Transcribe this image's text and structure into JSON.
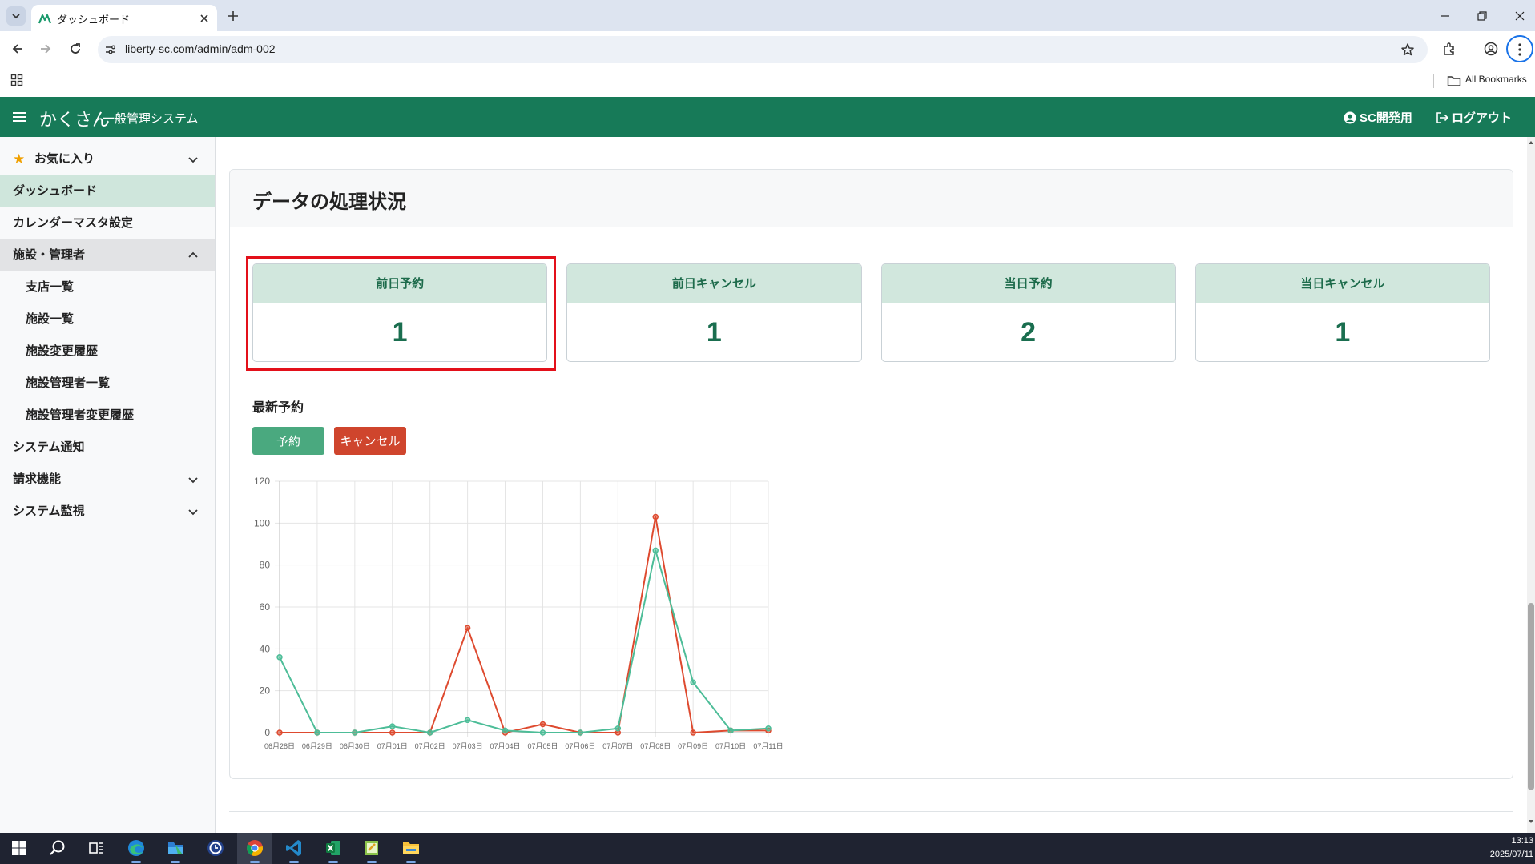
{
  "browser": {
    "tab_title": "ダッシュボード",
    "url": "liberty-sc.com/admin/adm-002",
    "bookmarks_folder": "All Bookmarks"
  },
  "app_header": {
    "brand": "かくさん",
    "system_name": "一般管理システム",
    "user_label": "SC開発用",
    "logout_label": "ログアウト"
  },
  "sidebar": {
    "items": [
      {
        "label": "お気に入り",
        "icon": "star-icon",
        "expandable": true,
        "expanded": false
      },
      {
        "label": "ダッシュボード",
        "active": true
      },
      {
        "label": "カレンダーマスタ設定"
      },
      {
        "label": "施設・管理者",
        "expandable": true,
        "expanded": true,
        "children": [
          {
            "label": "支店一覧"
          },
          {
            "label": "施設一覧"
          },
          {
            "label": "施設変更履歴"
          },
          {
            "label": "施設管理者一覧"
          },
          {
            "label": "施設管理者変更履歴"
          }
        ]
      },
      {
        "label": "システム通知"
      },
      {
        "label": "請求機能",
        "expandable": true,
        "expanded": false
      },
      {
        "label": "システム監視",
        "expandable": true,
        "expanded": false
      }
    ]
  },
  "main": {
    "card_title": "データの処理状況",
    "stats": [
      {
        "label": "前日予約",
        "value": 1,
        "highlighted": true
      },
      {
        "label": "前日キャンセル",
        "value": 1
      },
      {
        "label": "当日予約",
        "value": 2
      },
      {
        "label": "当日キャンセル",
        "value": 1
      }
    ],
    "latest_section_label": "最新予約"
  },
  "chart_data": {
    "type": "line",
    "x": [
      "06月28日",
      "06月29日",
      "06月30日",
      "07月01日",
      "07月02日",
      "07月03日",
      "07月04日",
      "07月05日",
      "07月06日",
      "07月07日",
      "07月08日",
      "07月09日",
      "07月10日",
      "07月11日"
    ],
    "series": [
      {
        "name": "予約",
        "color": "#4dbd98",
        "button_color": "#4aa97f",
        "values": [
          36,
          0,
          0,
          3,
          0,
          6,
          1,
          0,
          0,
          2,
          87,
          24,
          1,
          2
        ]
      },
      {
        "name": "キャンセル",
        "color": "#de4a2f",
        "button_color": "#cf452d",
        "values": [
          0,
          0,
          0,
          0,
          0,
          50,
          0,
          4,
          0,
          0,
          103,
          0,
          1,
          1
        ]
      }
    ],
    "ylim": [
      0,
      120
    ],
    "y_ticks": [
      0,
      20,
      40,
      60,
      80,
      100,
      120
    ],
    "grid": true,
    "legend": "top-left"
  },
  "taskbar": {
    "time": "13:13",
    "date": "2025/07/11",
    "apps": [
      "windows-start-icon",
      "search-icon",
      "task-view-icon",
      "edge-icon",
      "files-app-icon",
      "clock-app-icon",
      "chrome-icon",
      "vscode-icon",
      "excel-icon",
      "notepad-icon",
      "file-explorer-icon"
    ],
    "active_app": "chrome-icon"
  },
  "colors": {
    "header_green": "#177a58",
    "stat_header_bg": "#d1e7dd",
    "stat_value": "#1a6e4f",
    "active_nav_bg": "#cfe6dc",
    "highlight_red": "#e3101a"
  }
}
